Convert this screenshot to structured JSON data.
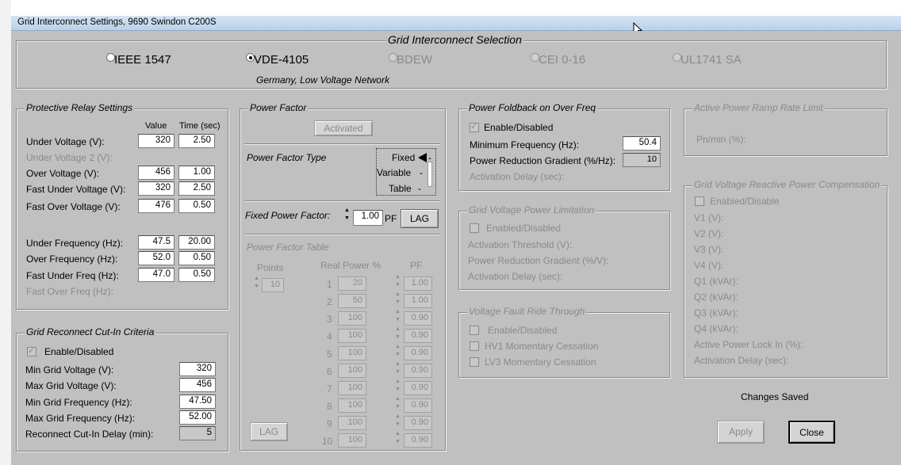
{
  "window_title": "Grid Interconnect Settings,  9690 Swindon C200S",
  "selection": {
    "legend": "Grid Interconnect Selection",
    "options": [
      {
        "label": "IEEE 1547",
        "selected": false,
        "enabled": true
      },
      {
        "label": "VDE-4105",
        "selected": true,
        "enabled": true
      },
      {
        "label": "BDEW",
        "selected": false,
        "enabled": false
      },
      {
        "label": "CEI 0-16",
        "selected": false,
        "enabled": false
      },
      {
        "label": "UL1741 SA",
        "selected": false,
        "enabled": false
      }
    ],
    "description": "Germany, Low Voltage Network"
  },
  "relay": {
    "legend": "Protective Relay Settings",
    "col_value": "Value",
    "col_time": "Time (sec)",
    "rows": [
      {
        "label": "Under Voltage (V):",
        "value": "320",
        "time": "2.50",
        "enabled": true
      },
      {
        "label": "Under Voltage 2 (V):",
        "value": "",
        "time": "",
        "enabled": false
      },
      {
        "label": "Over Voltage (V):",
        "value": "456",
        "time": "1.00",
        "enabled": true
      },
      {
        "label": "Fast Under Voltage (V):",
        "value": "320",
        "time": "2.50",
        "enabled": true
      },
      {
        "label": "Fast Over Voltage (V):",
        "value": "476",
        "time": "0.50",
        "enabled": true
      },
      {
        "label": "Under Frequency (Hz):",
        "value": "47.5",
        "time": "20.00",
        "enabled": true
      },
      {
        "label": "Over Frequency (Hz):",
        "value": "52.0",
        "time": "0.50",
        "enabled": true
      },
      {
        "label": "Fast Under Freq (Hz):",
        "value": "47.0",
        "time": "0.50",
        "enabled": true
      },
      {
        "label": "Fast Over Freq (Hz):",
        "value": "",
        "time": "",
        "enabled": false
      }
    ]
  },
  "reconnect": {
    "legend": "Grid Reconnect Cut-In Criteria",
    "enable_label": "Enable/Disabled",
    "enable_checked": true,
    "rows": [
      {
        "label": "Min Grid Voltage (V):",
        "value": "320"
      },
      {
        "label": "Max Grid Voltage (V):",
        "value": "456"
      },
      {
        "label": "Min Grid Frequency (Hz):",
        "value": "47.50"
      },
      {
        "label": "Max Grid Frequency (Hz):",
        "value": "52.00"
      },
      {
        "label": "Reconnect Cut-In Delay (min):",
        "value": "5"
      }
    ]
  },
  "pf": {
    "legend": "Power Factor",
    "activated_label": "Activated",
    "type_label": "Power Factor Type",
    "type_options": [
      "Fixed",
      "Variable",
      "Table"
    ],
    "fixed_label": "Fixed Power Factor:",
    "fixed_value": "1.00",
    "fixed_unit": "PF",
    "lag_label": "LAG",
    "table_legend": "Power Factor Table",
    "points_label": "Points",
    "points_value": "10",
    "col_real": "Real Power %",
    "col_pf": "PF",
    "table_rows": [
      {
        "n": "1",
        "real": "20",
        "pf": "1.00"
      },
      {
        "n": "2",
        "real": "50",
        "pf": "1.00"
      },
      {
        "n": "3",
        "real": "100",
        "pf": "0.90"
      },
      {
        "n": "4",
        "real": "100",
        "pf": "0.90"
      },
      {
        "n": "5",
        "real": "100",
        "pf": "0.90"
      },
      {
        "n": "6",
        "real": "100",
        "pf": "0.90"
      },
      {
        "n": "7",
        "real": "100",
        "pf": "0.90"
      },
      {
        "n": "8",
        "real": "100",
        "pf": "0.90"
      },
      {
        "n": "9",
        "real": "100",
        "pf": "0.90"
      },
      {
        "n": "10",
        "real": "100",
        "pf": "0.90"
      }
    ],
    "table_lag_label": "LAG"
  },
  "foldback": {
    "legend": "Power Foldback on Over Freq",
    "enable_label": "Enable/Disabled",
    "enable_checked": true,
    "min_freq_label": "Minimum Frequency (Hz):",
    "min_freq_value": "50.4",
    "gradient_label": "Power Reduction Gradient (%/Hz):",
    "gradient_value": "10",
    "delay_label": "Activation Delay (sec):"
  },
  "gvpl": {
    "legend": "Grid Voltage Power Limitation",
    "enable_label": "Enabled/Disabled",
    "threshold_label": "Activation Threshold (V):",
    "gradient_label": "Power Reduction Gradient (%/V):",
    "delay_label": "Activation Delay (sec):"
  },
  "vfrt": {
    "legend": "Voltage Fault Ride Through",
    "items": [
      "Enable/Disabled",
      "HV1 Momentary Cessation",
      "LV3 Momentary Cessation"
    ]
  },
  "ramp": {
    "legend": "Active Power Ramp Rate Limit",
    "label": "Pn/min (%):"
  },
  "gvrpc": {
    "legend": "Grid Voltage Reactive Power Compensation",
    "enable_label": "Enabled/Disable",
    "labels": [
      "V1 (V):",
      "V2 (V):",
      "V3 (V):",
      "V4 (V):",
      "Q1 (kVAr):",
      "Q2 (kVAr):",
      "Q3 (kVAr):",
      "Q4 (kVAr):",
      "Active Power Lock In (%):",
      "Activation Delay (sec):"
    ]
  },
  "status": "Changes Saved",
  "apply_label": "Apply",
  "close_label": "Close"
}
